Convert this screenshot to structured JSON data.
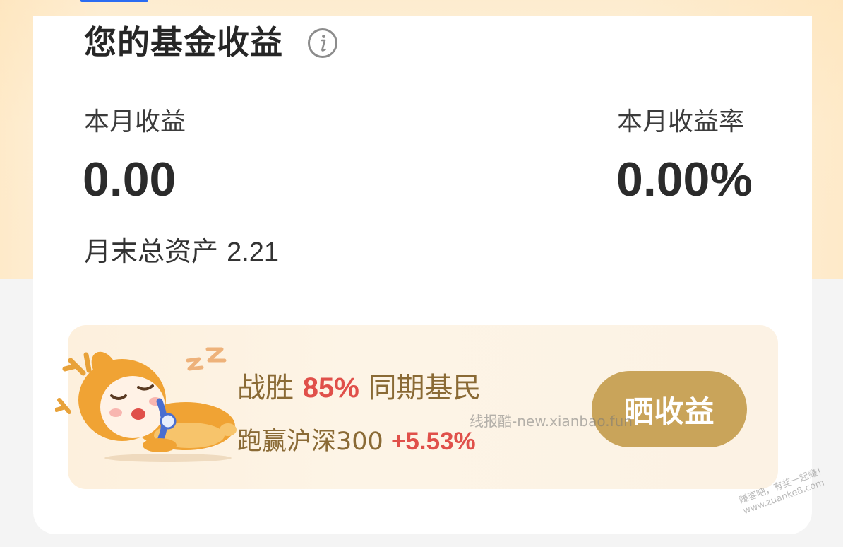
{
  "header": {
    "title": "您的基金收益",
    "info_icon": "info-icon"
  },
  "summary": {
    "month_profit_label": "本月收益",
    "month_profit_value": "0.00",
    "month_rate_label": "本月收益率",
    "month_rate_value": "0.00%",
    "month_end_assets_label": "月末总资产",
    "month_end_assets_value": "2.21"
  },
  "banner": {
    "mascot_icon": "deer-mascot-sleeping-icon",
    "beat_prefix": "战胜",
    "beat_percent": "85%",
    "beat_suffix": "同期基民",
    "run_prefix": "跑赢沪深300",
    "run_value": "+5.53%",
    "share_button": "晒收益"
  },
  "watermarks": {
    "center": "线报酷-new.xianbao.fun",
    "corner_line1": "赚客吧，有奖一起赚！",
    "corner_line2": "www.zuanke8.com"
  },
  "colors": {
    "accent_red": "#e0504a",
    "gold_text": "#8a6a35",
    "button_gold": "#c9a45a"
  }
}
